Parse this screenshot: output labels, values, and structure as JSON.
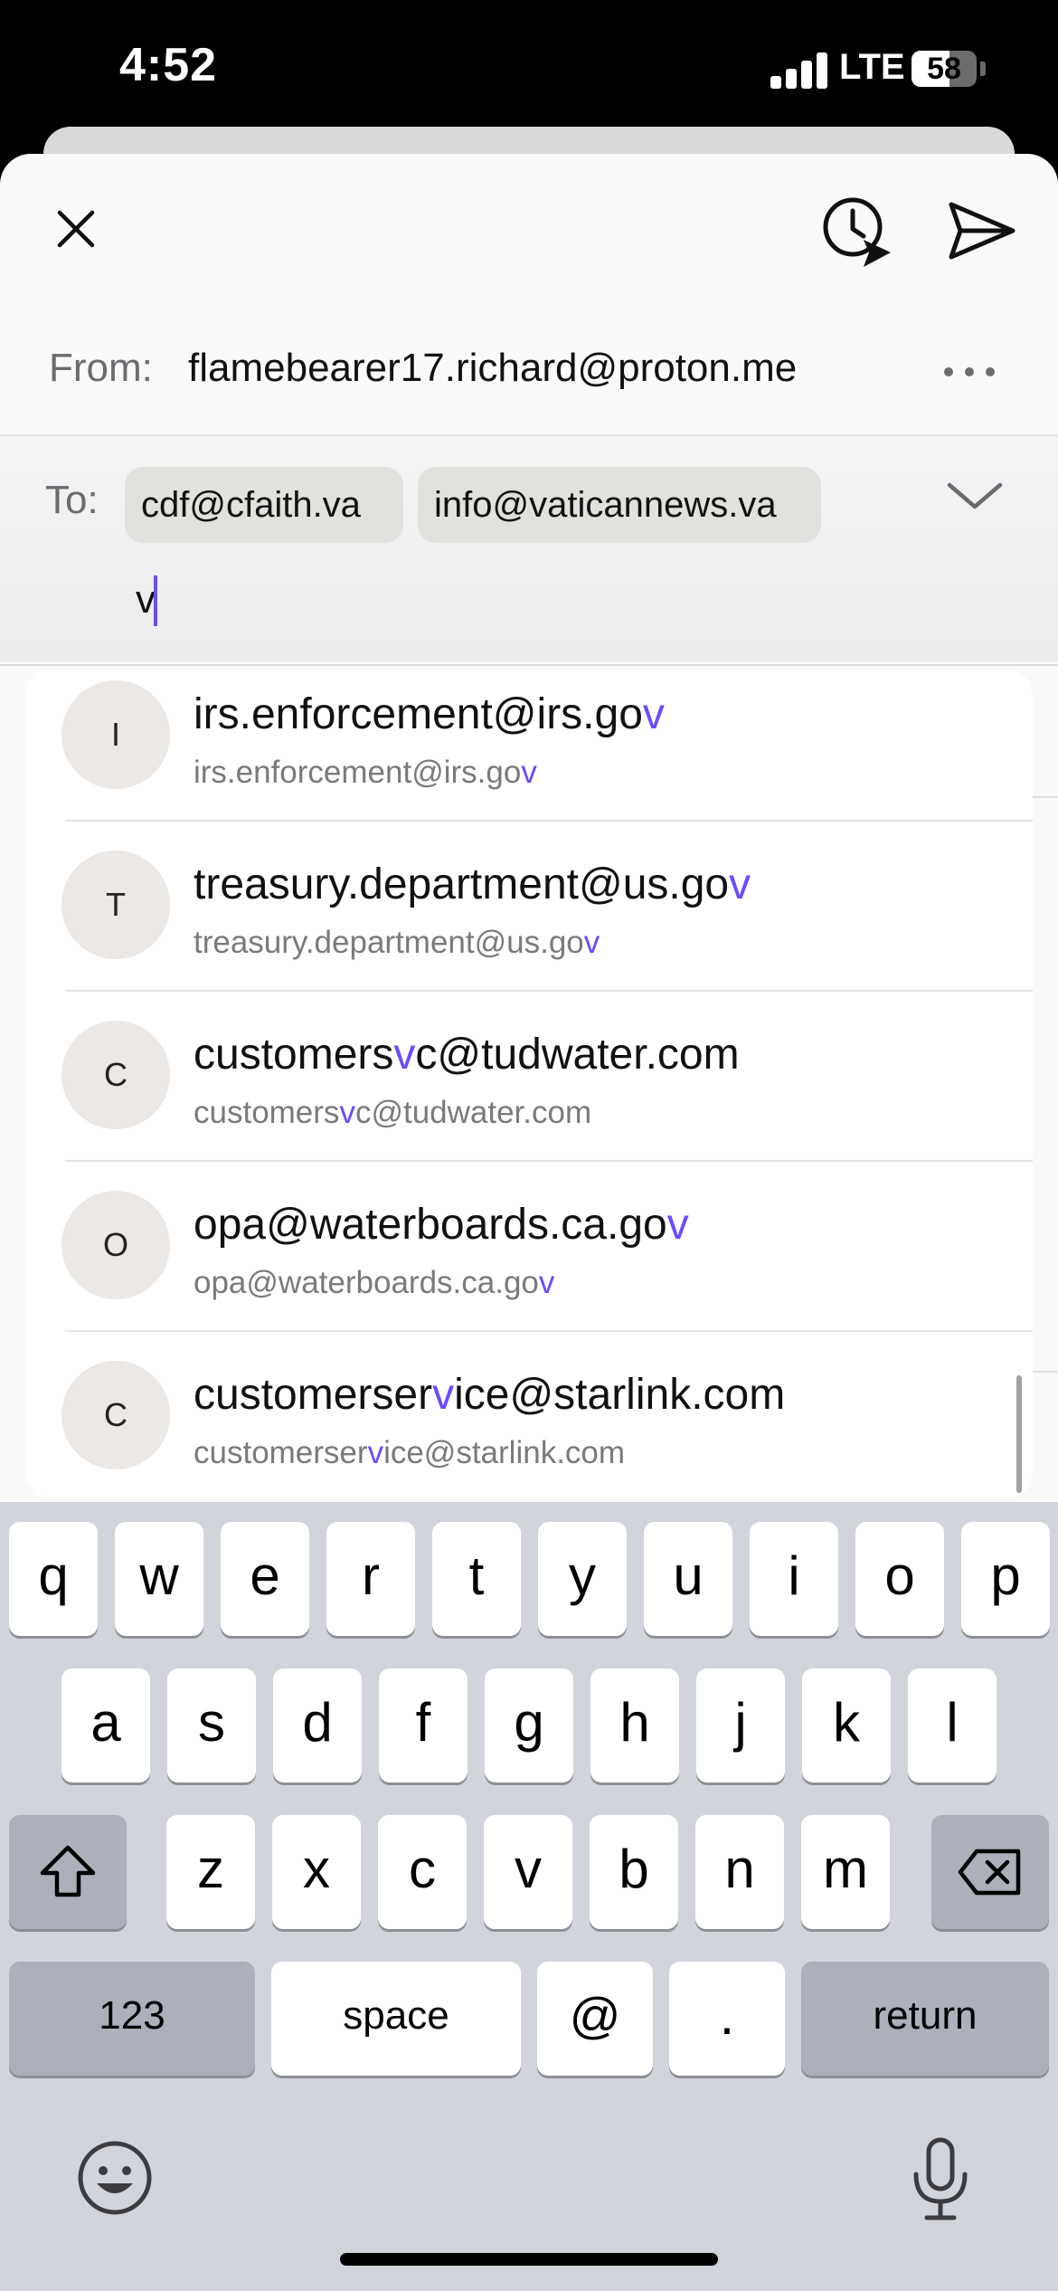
{
  "status_bar": {
    "time": "4:52",
    "network": "LTE",
    "battery": "58",
    "battery_level": 0.58
  },
  "toolbar": {
    "close_icon": "close-icon",
    "schedule_icon": "schedule-send-icon",
    "send_icon": "send-icon"
  },
  "from": {
    "label": "From:",
    "value": "flamebearer17.richard@proton.me",
    "more_icon": "more-icon"
  },
  "to": {
    "label": "To:",
    "chips": [
      "cdf@cfaith.va",
      "info@vaticannews.va"
    ],
    "input_value": "v",
    "expand_icon": "chevron-down-icon"
  },
  "suggestions": [
    {
      "initial": "I",
      "name_pre": "irs.enforcement@irs.go",
      "name_hl": "v",
      "name_post": "",
      "sub_pre": "irs.enforcement@irs.go",
      "sub_hl": "v",
      "sub_post": ""
    },
    {
      "initial": "T",
      "name_pre": "treasury.department@us.go",
      "name_hl": "v",
      "name_post": "",
      "sub_pre": "treasury.department@us.go",
      "sub_hl": "v",
      "sub_post": ""
    },
    {
      "initial": "C",
      "name_pre": "customers",
      "name_hl": "v",
      "name_post": "c@tudwater.com",
      "sub_pre": "customers",
      "sub_hl": "v",
      "sub_post": "c@tudwater.com"
    },
    {
      "initial": "O",
      "name_pre": "opa@waterboards.ca.go",
      "name_hl": "v",
      "name_post": "",
      "sub_pre": "opa@waterboards.ca.go",
      "sub_hl": "v",
      "sub_post": ""
    },
    {
      "initial": "C",
      "name_pre": "customerser",
      "name_hl": "v",
      "name_post": "ice@starlink.com",
      "sub_pre": "customerser",
      "sub_hl": "v",
      "sub_post": "ice@starlink.com"
    }
  ],
  "keyboard": {
    "row1": [
      "q",
      "w",
      "e",
      "r",
      "t",
      "y",
      "u",
      "i",
      "o",
      "p"
    ],
    "row2": [
      "a",
      "s",
      "d",
      "f",
      "g",
      "h",
      "j",
      "k",
      "l"
    ],
    "row3": [
      "z",
      "x",
      "c",
      "v",
      "b",
      "n",
      "m"
    ],
    "numbers_label": "123",
    "space_label": "space",
    "at_label": "@",
    "dot_label": ".",
    "return_label": "return",
    "shift_icon": "shift-icon",
    "backspace_icon": "backspace-icon",
    "emoji_icon": "emoji-icon",
    "mic_icon": "microphone-icon"
  },
  "colors": {
    "accent": "#6d4aff",
    "keyboard_bg": "#d2d4db",
    "chip_bg": "#e3e1de"
  }
}
